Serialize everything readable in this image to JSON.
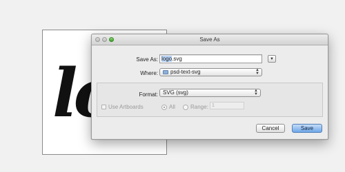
{
  "document": {
    "logo_text": "lo"
  },
  "dialog": {
    "title": "Save As",
    "save_as_label": "Save As:",
    "filename_selected": "logo",
    "filename_rest": ".svg",
    "expand_icon": "triangle-down-icon",
    "where_label": "Where:",
    "where_value": "psd-text-svg",
    "format_label": "Format:",
    "format_value": "SVG (svg)",
    "use_artboards_label": "Use Artboards",
    "all_label": "All",
    "range_label": "Range:",
    "range_value": "1",
    "cancel_label": "Cancel",
    "save_label": "Save"
  },
  "colors": {
    "save_button": "#6fa7e8",
    "zoom_light": "#5fbf47"
  }
}
